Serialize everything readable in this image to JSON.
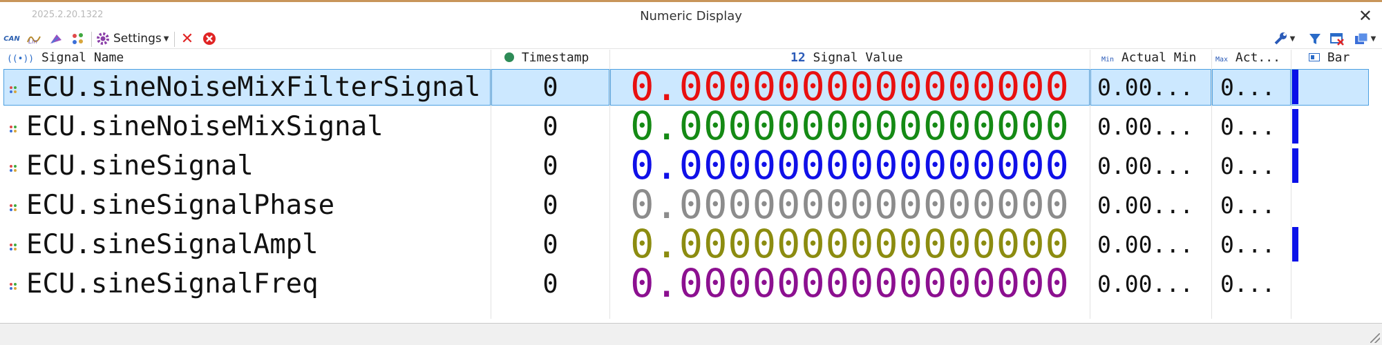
{
  "window": {
    "title": "Numeric Display",
    "version": "2025.2.20.1322"
  },
  "toolbar": {
    "settings_label": "Settings",
    "can_label": "CAN",
    "icons": [
      "can-icon",
      "lin-icon",
      "signal-tool-icon",
      "signal-group-icon",
      "gear-icon",
      "delete-icon",
      "clear-icon",
      "wrench-icon",
      "filter-icon",
      "remove-view-icon",
      "export-icon"
    ]
  },
  "columns": {
    "name": "Signal Name",
    "timestamp": "Timestamp",
    "value_badge": "12",
    "value": "Signal Value",
    "min_badge": "Min",
    "min": "Actual Min",
    "max_badge": "Max",
    "max": "Act...",
    "bar": "Bar"
  },
  "rows": [
    {
      "name": "ECU.sineNoiseMixFilterSignal",
      "timestamp": "0",
      "value": "0.0000000000000000",
      "min": "0.00...",
      "max": "0...",
      "color": "#e81010",
      "bar_level": 1,
      "selected": true
    },
    {
      "name": "ECU.sineNoiseMixSignal",
      "timestamp": "0",
      "value": "0.0000000000000000",
      "min": "0.00...",
      "max": "0...",
      "color": "#158a15",
      "bar_level": 1,
      "selected": false
    },
    {
      "name": "ECU.sineSignal",
      "timestamp": "0",
      "value": "0.0000000000000000",
      "min": "0.00...",
      "max": "0...",
      "color": "#1010e8",
      "bar_level": 1,
      "selected": false
    },
    {
      "name": "ECU.sineSignalPhase",
      "timestamp": "0",
      "value": "0.0000000000000000",
      "min": "0.00...",
      "max": "0...",
      "color": "#8c8c8c",
      "bar_level": 0,
      "selected": false
    },
    {
      "name": "ECU.sineSignalAmpl",
      "timestamp": "0",
      "value": "0.0000000000000000",
      "min": "0.00...",
      "max": "0...",
      "color": "#8c8c10",
      "bar_level": 1,
      "selected": false
    },
    {
      "name": "ECU.sineSignalFreq",
      "timestamp": "0",
      "value": "0.0000000000000000",
      "min": "0.00...",
      "max": "0...",
      "color": "#8c1090",
      "bar_level": 0,
      "selected": false
    }
  ],
  "colors": {
    "selection": "#cce8ff",
    "bar": "#0a10e8",
    "titlebar_accent": "#c8955a"
  }
}
